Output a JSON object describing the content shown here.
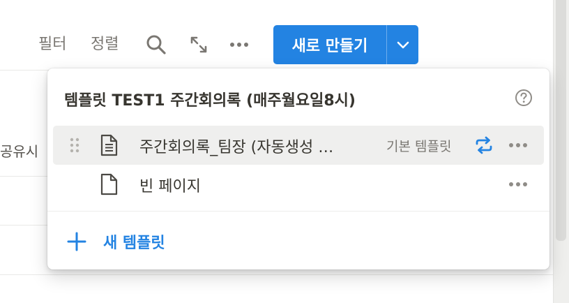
{
  "toolbar": {
    "filter_label": "필터",
    "sort_label": "정렬",
    "search_icon": "search-icon",
    "expand_icon": "expand-icon",
    "more_icon": "more-icon",
    "new_button_label": "새로 만들기",
    "new_button_color": "#2383e2"
  },
  "background_table": {
    "column_label": "공유시"
  },
  "template_menu": {
    "title": "템플릿 TEST1 주간회의록 (매주월요일8시)",
    "templates": [
      {
        "name": "주간회의록_팀장 (자동생성 …",
        "badge": "기본 템플릿",
        "icon": "document-icon",
        "repeat_icon": "repeat-icon"
      },
      {
        "name": "빈 페이지",
        "icon": "blank-page-icon"
      }
    ],
    "new_template_label": "새 템플릿",
    "accent_color": "#2383e2"
  }
}
